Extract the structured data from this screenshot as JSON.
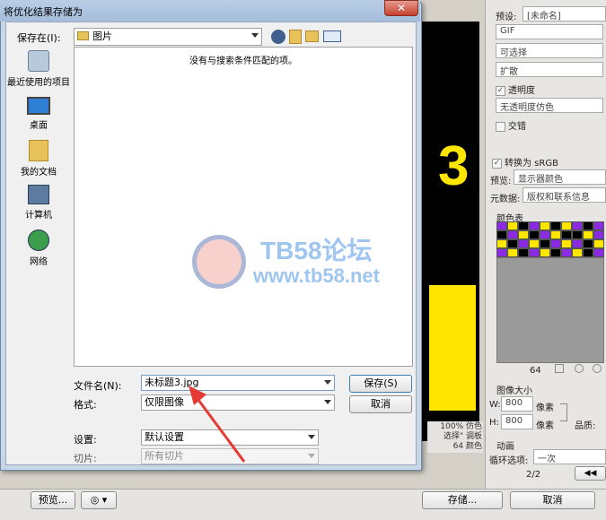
{
  "dialog": {
    "title": "将优化结果存储为",
    "close_label": "✕",
    "save_in_label": "保存在(I):",
    "save_in_value": "图片",
    "empty_message": "没有与搜索条件匹配的项。",
    "places": [
      {
        "label": "最近使用的项目",
        "icon": "recent-icon"
      },
      {
        "label": "桌面",
        "icon": "desktop-icon"
      },
      {
        "label": "我的文档",
        "icon": "documents-icon"
      },
      {
        "label": "计算机",
        "icon": "computer-icon"
      },
      {
        "label": "网络",
        "icon": "network-icon"
      }
    ],
    "filename_label": "文件名(N):",
    "filename_value": "未标题3.jpg",
    "format_label": "格式:",
    "format_value": "仅限图像",
    "settings_label": "设置:",
    "settings_value": "默认设置",
    "slices_label": "切片:",
    "slices_value": "所有切片",
    "save_button": "保存(S)",
    "cancel_button": "取消"
  },
  "right_panel": {
    "preset_label": "预设:",
    "preset_value": "[未命名]",
    "format_value": "GIF",
    "selective_value": "可选择",
    "dither_value": "扩散",
    "transparency_label": "透明度",
    "transparency_dither_value": "无透明度仿色",
    "interlaced_label": "交错",
    "convert_srgb_label": "转换为 sRGB",
    "preview_label": "预览:",
    "preview_value": "显示器颜色",
    "metadata_label": "元数据:",
    "metadata_value": "版权和联系信息",
    "color_table_label": "颜色表",
    "color_count": "64",
    "image_size_label": "图像大小",
    "width_label": "W:",
    "width_value": "800",
    "height_label": "H:",
    "height_value": "800",
    "pixel_unit": "像素",
    "quality_label": "品质:",
    "animation_label": "动画",
    "loop_label": "循环选项:",
    "loop_value": "一次",
    "frame_counter": "2/2"
  },
  "canvas_info": {
    "line1": "100% 仿色",
    "line2": "选择\" 调板",
    "line3": "64 颜色"
  },
  "bottom_bar": {
    "preview_button": "预览...",
    "store_button": "存储...",
    "cancel_button": "取消"
  },
  "watermark": {
    "text": "TB58论坛",
    "url": "www.tb58.net"
  },
  "colors": {
    "accent": "#7a9cc9",
    "canvas_yellow": "#ffe600",
    "arrow_red": "#e53935"
  },
  "color_table": [
    "#8a2be2",
    "#ffe600",
    "#000",
    "#8a2be2",
    "#ffe600",
    "#000",
    "#ffe600",
    "#8a2be2",
    "#000",
    "#8a2be2",
    "#000",
    "#8a2be2",
    "#ffe600",
    "#000",
    "#8a2be2",
    "#ffe600",
    "#000",
    "#000",
    "#ffe600",
    "#8a2be2",
    "#ffe600",
    "#000",
    "#8a2be2",
    "#ffe600",
    "#000",
    "#8a2be2",
    "#ffe600",
    "#8a2be2",
    "#000",
    "#ffe600",
    "#8a2be2",
    "#ffe600",
    "#000",
    "#8a2be2",
    "#ffe600",
    "#000",
    "#8a2be2",
    "#ffe600",
    "#000",
    "#8a2be2"
  ]
}
